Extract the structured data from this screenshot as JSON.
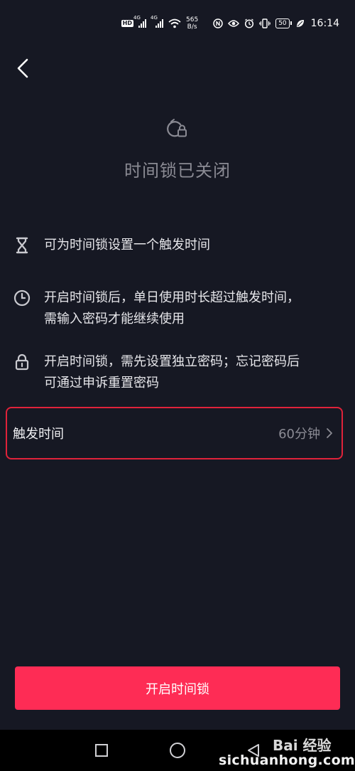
{
  "status_bar": {
    "hd": "HD",
    "sim1": "4G",
    "sim2": "4G",
    "speed_value": "565",
    "speed_unit": "B/s",
    "battery": "50",
    "time": "16:14"
  },
  "header": {
    "title": "时间锁已关闭"
  },
  "features": [
    {
      "icon": "hourglass-icon",
      "text": "可为时间锁设置一个触发时间"
    },
    {
      "icon": "clock-icon",
      "text_line1": "开启时间锁后，单日使用时长超过触发时间，",
      "text_line2": "需输入密码才能继续使用"
    },
    {
      "icon": "lock-icon",
      "text_line1": "开启时间锁，需先设置独立密码；忘记密码后",
      "text_line2": "可通过申诉重置密码"
    }
  ],
  "trigger": {
    "label": "触发时间",
    "value": "60分钟"
  },
  "primary_button": {
    "label": "开启时间锁"
  },
  "watermark": {
    "brand": "Bai 经验",
    "site": "sichuanhong.com"
  },
  "colors": {
    "background": "#161823",
    "accent": "#fe2c55",
    "highlight_border": "#e0223a",
    "muted_text": "#8b8b94"
  }
}
